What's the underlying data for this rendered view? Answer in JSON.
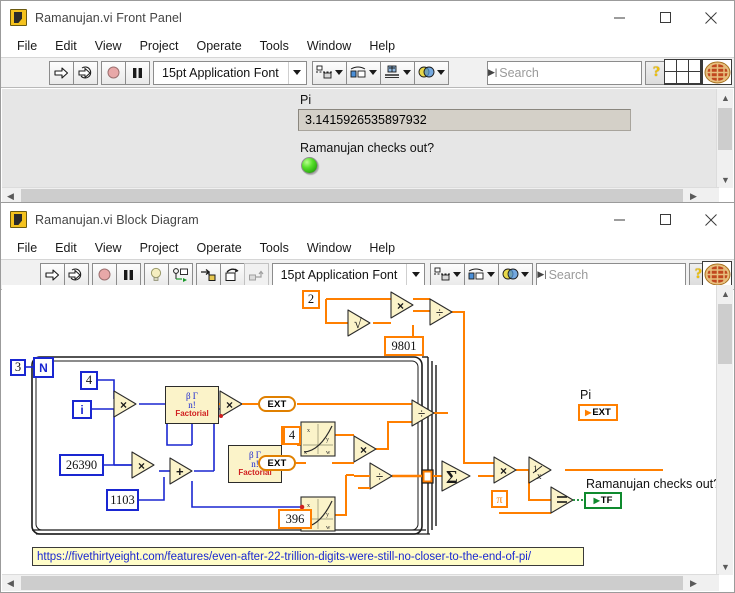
{
  "front_panel": {
    "title": "Ramanujan.vi Front Panel",
    "app_icon": "labview-vi-icon",
    "window_buttons": {
      "minimize": "minimize-icon",
      "maximize": "maximize-icon",
      "close": "close-icon"
    },
    "menus": [
      "File",
      "Edit",
      "View",
      "Project",
      "Operate",
      "Tools",
      "Window",
      "Help"
    ],
    "toolbar": {
      "run": "run-arrow-icon",
      "run_continuously": "run-continuously-icon",
      "abort": "abort-execution-icon",
      "pause": "pause-icon",
      "font": "15pt Application Font",
      "align_objects": "align-objects-icon",
      "distribute_objects": "distribute-objects-icon",
      "resize_objects": "resize-objects-icon",
      "reorder": "reorder-icon",
      "search_placeholder": "Search",
      "search_value": "",
      "search_icon": "magnifier-icon",
      "help": "context-help-icon",
      "connector_pane": "connector-pane-icon",
      "vi_icon": "pie-vi-icon"
    },
    "controls": {
      "pi_label": "Pi",
      "pi_value": "3.1415926535897932",
      "bool_label": "Ramanujan checks out?",
      "bool_state": "true",
      "led_color": "#4cd01f"
    }
  },
  "block_diagram": {
    "title": "Ramanujan.vi Block Diagram",
    "app_icon": "labview-vi-icon",
    "window_buttons": {
      "minimize": "minimize-icon",
      "maximize": "maximize-icon",
      "close": "close-icon"
    },
    "menus": [
      "File",
      "Edit",
      "View",
      "Project",
      "Operate",
      "Tools",
      "Window",
      "Help"
    ],
    "toolbar": {
      "run": "run-arrow-icon",
      "run_continuously": "run-continuously-icon",
      "abort": "abort-execution-icon",
      "pause": "pause-icon",
      "highlight_execution": "lightbulb-icon",
      "retain_wire_values": "retain-wire-values-icon",
      "step_into": "step-into-icon",
      "step_over": "step-over-icon",
      "step_out": "step-out-icon",
      "font": "15pt Application Font",
      "align_objects": "align-objects-icon",
      "distribute_objects": "distribute-objects-icon",
      "reorder": "reorder-icon",
      "search_placeholder": "Search",
      "search_value": "",
      "search_icon": "magnifier-icon",
      "help": "context-help-icon",
      "vi_icon": "pie-vi-icon"
    },
    "diagram": {
      "loop_count": "3",
      "loop_n_terminal": "N",
      "loop_i_terminal": "i",
      "const_4_top": "4",
      "const_26390": "26390",
      "const_1103": "1103",
      "const_4_mid": "4",
      "const_396": "396",
      "const_2": "2",
      "const_9801": "9801",
      "const_pi": "π",
      "factorial_label_1": "Factorial",
      "factorial_label_2": "Factorial",
      "factorial_sym_top": "β Γ",
      "factorial_sym_mid": "n!",
      "ext_1": "EXT",
      "ext_2": "EXT",
      "ext_3": "EXT",
      "sum_symbol": "Σ",
      "reciprocal_symbol": "1/x",
      "sqrt_symbol": "√",
      "multiply_symbol": "×",
      "divide_symbol": "÷",
      "add_symbol": "+",
      "equal_symbol": "=",
      "pi_indicator_label": "Pi",
      "pi_indicator_type": "EXT",
      "bool_indicator_label": "Ramanujan checks out?",
      "bool_indicator_type": "TF",
      "url_comment": "https://fivethirtyeight.com/features/even-after-22-trillion-digits-were-still-no-closer-to-the-end-of-pi/",
      "wire_color_orange": "#ff7f00",
      "wire_color_blue": "#1a27d1",
      "wire_color_green": "#0f8a2e"
    }
  }
}
